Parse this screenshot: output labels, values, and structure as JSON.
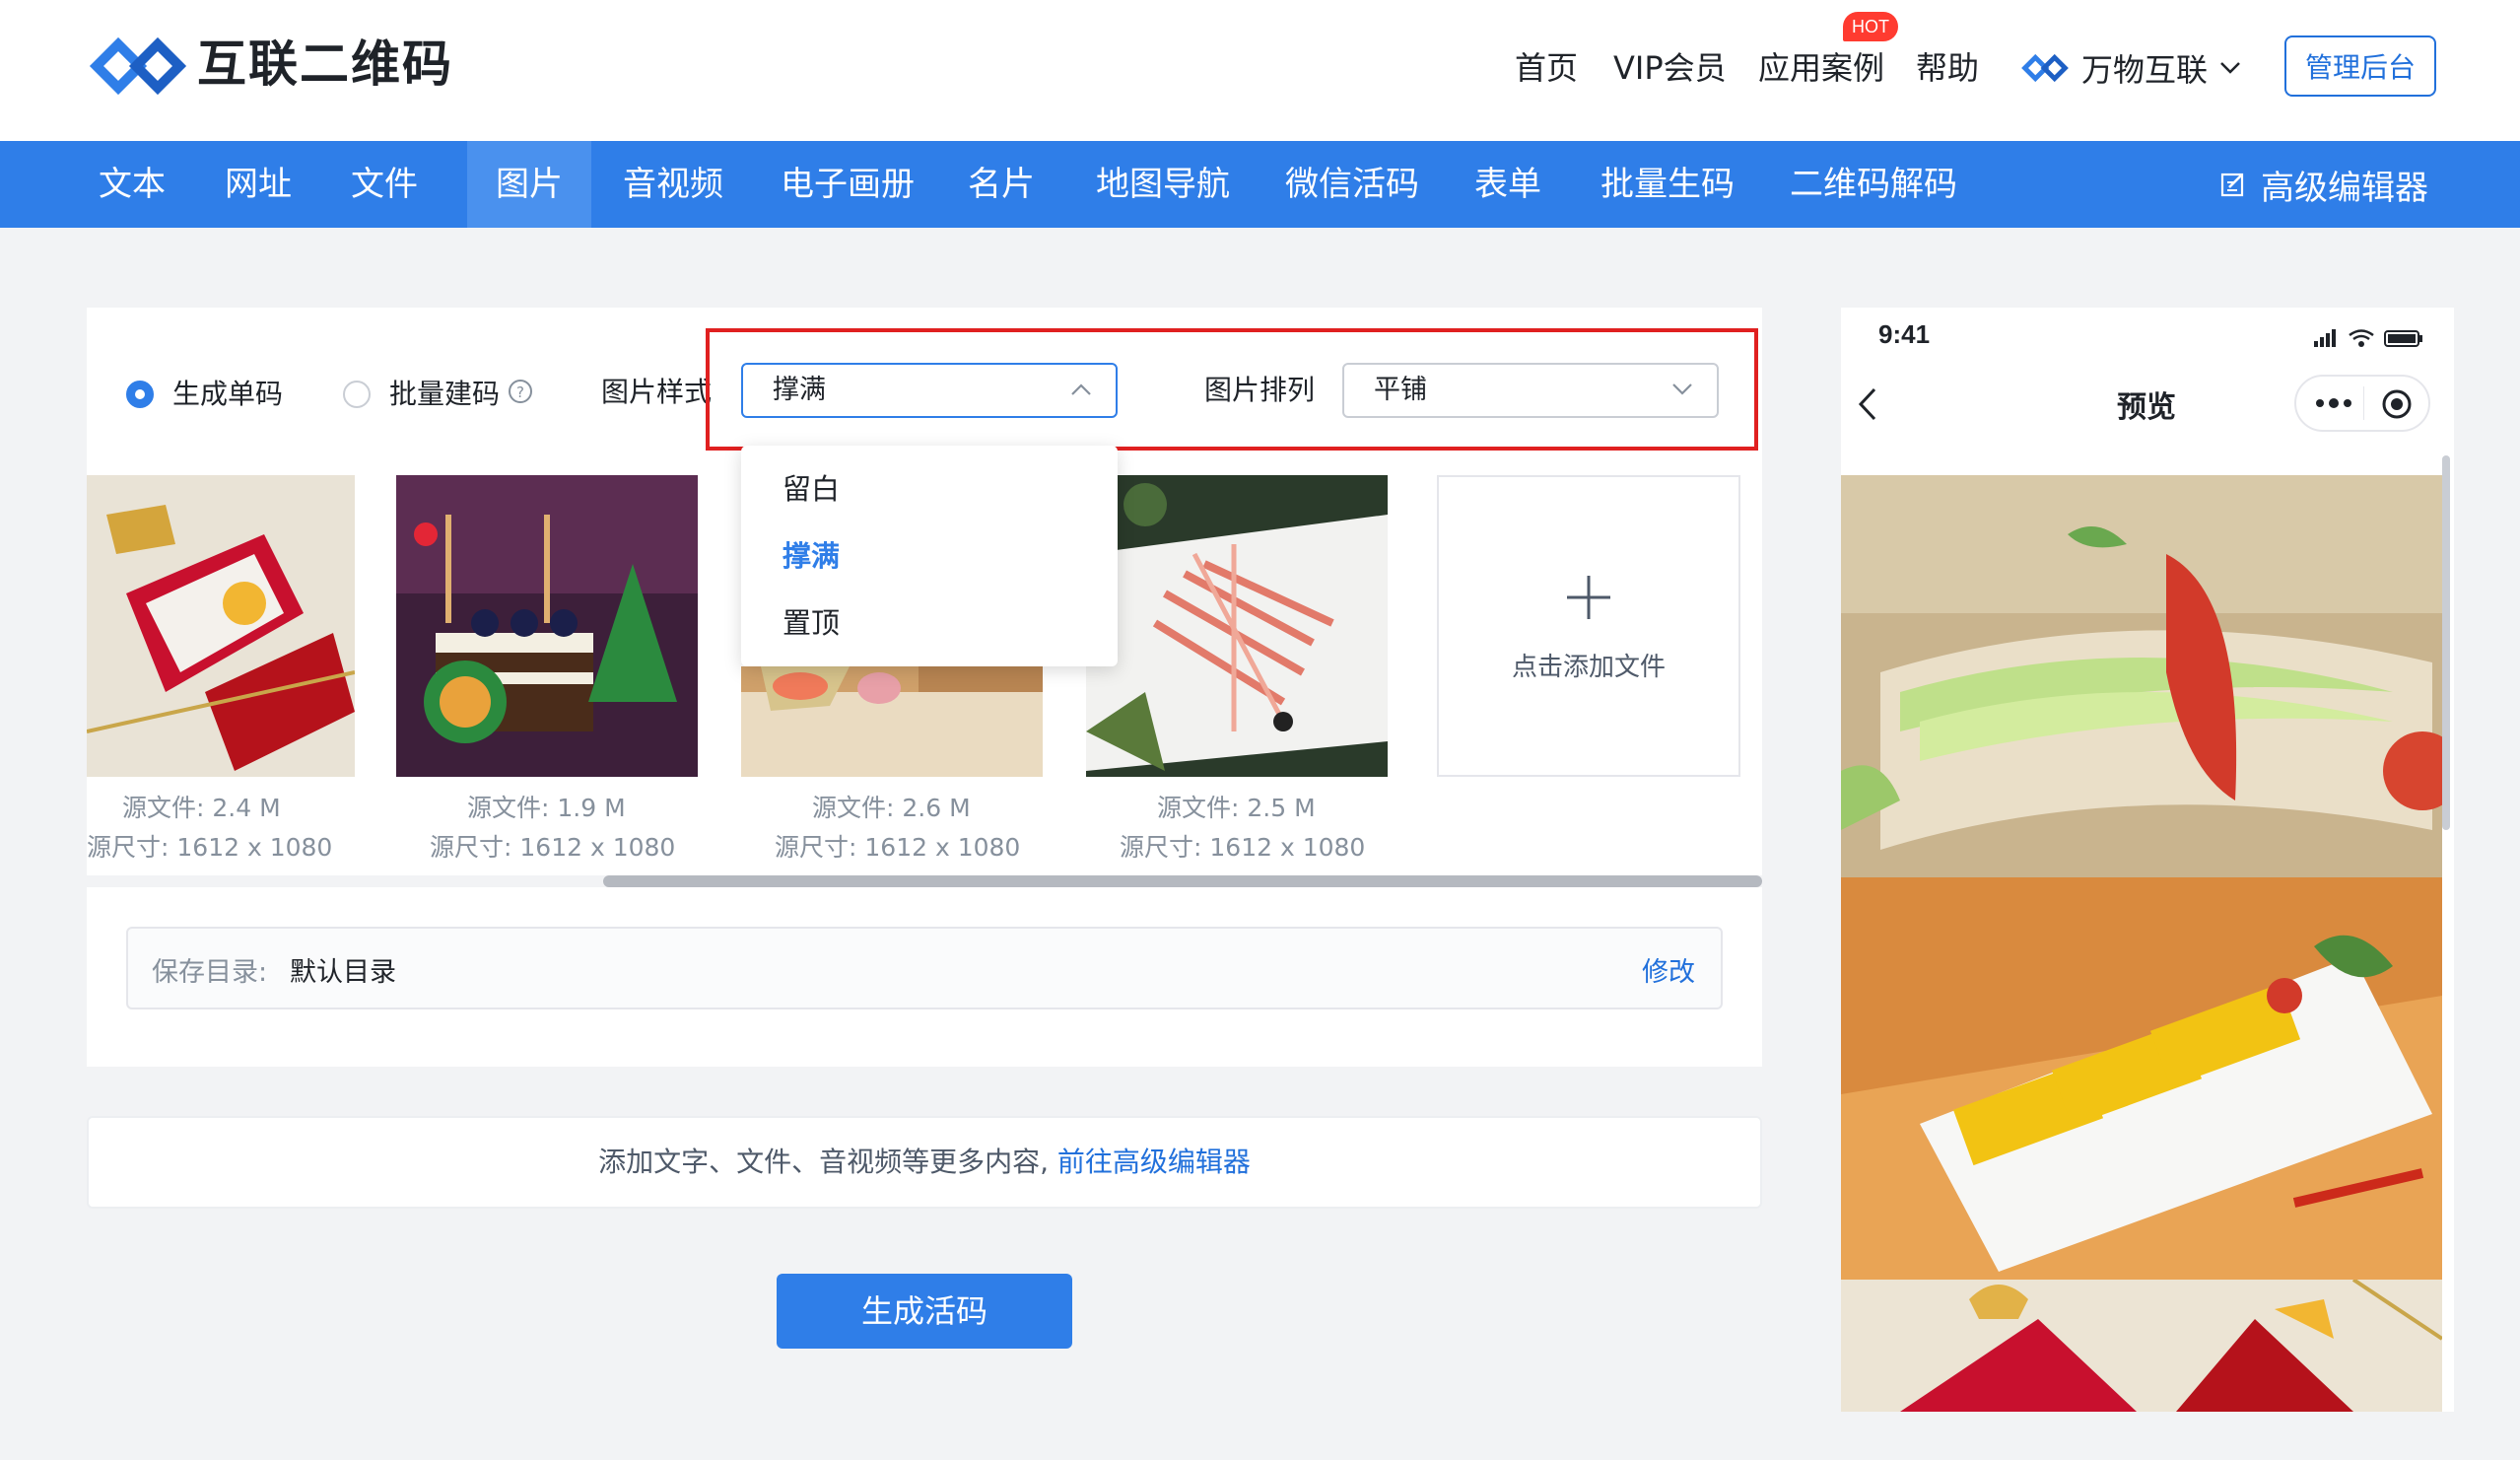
{
  "header": {
    "logo_text": "互联二维码",
    "nav": [
      "首页",
      "VIP会员",
      "应用案例",
      "帮助"
    ],
    "hot_badge": "HOT",
    "brand_dropdown": "万物互联",
    "admin_button": "管理后台"
  },
  "main_nav": {
    "items": [
      "文本",
      "网址",
      "文件",
      "图片",
      "音视频",
      "电子画册",
      "名片",
      "地图导航",
      "微信活码",
      "表单",
      "批量生码",
      "二维码解码"
    ],
    "active": "图片",
    "editor_link": "高级编辑器"
  },
  "form": {
    "radio_single": "生成单码",
    "radio_batch": "批量建码",
    "style_label": "图片样式",
    "style_value": "撑满",
    "arrange_label": "图片排列",
    "arrange_value": "平铺",
    "style_options": [
      "留白",
      "撑满",
      "置顶"
    ],
    "style_selected": "撑满"
  },
  "files": [
    {
      "size_label": "源文件:",
      "size": "2.4 M",
      "dim_label": "源尺寸:",
      "dim": "1612 x 1080"
    },
    {
      "size_label": "源文件:",
      "size": "1.9 M",
      "dim_label": "源尺寸:",
      "dim": "1612 x 1080"
    },
    {
      "size_label": "源文件:",
      "size": "2.6 M",
      "dim_label": "源尺寸:",
      "dim": "1612 x 1080"
    },
    {
      "size_label": "源文件:",
      "size": "2.5 M",
      "dim_label": "源尺寸:",
      "dim": "1612 x 1080"
    }
  ],
  "add_file": "点击添加文件",
  "save_dir": {
    "label": "保存目录:",
    "value": "默认目录",
    "action": "修改"
  },
  "tip": {
    "text": "添加文字、文件、音视频等更多内容,",
    "link": "前往高级编辑器"
  },
  "generate_button": "生成活码",
  "preview": {
    "time": "9:41",
    "title": "预览"
  },
  "colors": {
    "primary": "#2f7ee8",
    "highlight_box": "#e02020",
    "hot": "#ff3b30"
  }
}
